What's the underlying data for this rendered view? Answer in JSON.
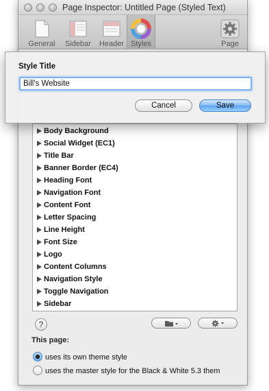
{
  "window": {
    "title": "Page Inspector: Untitled Page (Styled Text)"
  },
  "toolbar": {
    "tabs": [
      {
        "label": "General",
        "icon": "document-icon"
      },
      {
        "label": "Sidebar",
        "icon": "sidebar-layout-icon"
      },
      {
        "label": "Header",
        "icon": "header-layout-icon"
      },
      {
        "label": "Styles",
        "icon": "color-wheel-icon"
      },
      {
        "label": "Page",
        "icon": "gear-icon"
      }
    ],
    "selected": "Styles"
  },
  "style_list": {
    "items": [
      "Body Background",
      "Social Widget (EC1)",
      "Title Bar",
      "Banner Border (EC4)",
      "Heading Font",
      "Navigation Font",
      "Content Font",
      "Letter Spacing",
      "Line Height",
      "Font Size",
      "Logo",
      "Content Columns",
      "Navigation Style",
      "Toggle Navigation",
      "Sidebar"
    ]
  },
  "footer": {
    "help_label": "?",
    "this_page_label": "This page:",
    "radio_own": "uses its own theme style",
    "radio_master": "uses the master style for the Black & White 5.3 them"
  },
  "sheet": {
    "title": "Style Title",
    "input_value": "Bill's Website",
    "cancel_label": "Cancel",
    "save_label": "Save"
  }
}
